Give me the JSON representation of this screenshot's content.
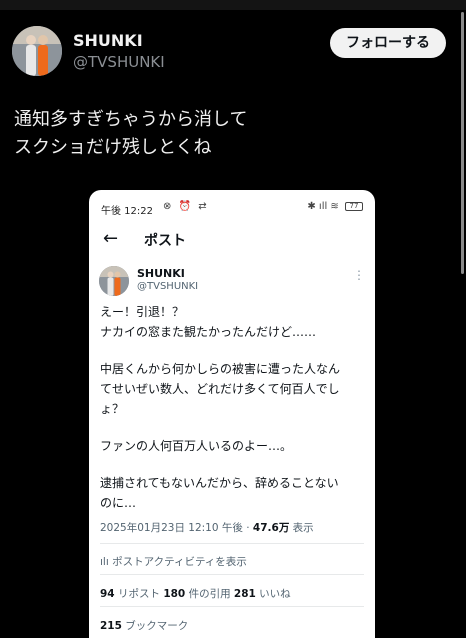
{
  "profile": {
    "name": "SHUNKI",
    "handle": "@TVSHUNKI",
    "follow_label": "フォローする"
  },
  "tweet": {
    "lines": [
      "通知多すぎちゃうから消して",
      "スクショだけ残しとくね"
    ]
  },
  "screenshot": {
    "status": {
      "time": "午後 12:22",
      "left_icons": "⊗ ⏰ ⇄",
      "right_icons": "✱ ıll ≋",
      "battery": "77"
    },
    "nav": {
      "back_icon": "back-arrow-icon",
      "title": "ポスト"
    },
    "author": {
      "name": "SHUNKI",
      "handle": "@TVSHUNKI",
      "more": "⋮"
    },
    "body": [
      "えー！引退！？",
      "ナカイの窓また観たかったんだけど……",
      "",
      "中居くんから何かしらの被害に遭った人なん",
      "てせいぜい数人、どれだけ多くて何百人でし",
      "ょ？",
      "",
      "ファンの人何百万人いるのよー…。",
      "",
      "逮捕されてもないんだから、辞めることない",
      "のに…"
    ],
    "meta": {
      "datetime": "2025年01月23日 12:10 午後 · ",
      "views": "47.6万",
      "views_suffix": " 表示"
    },
    "activity_label": "ポストアクティビティを表示",
    "stats": {
      "reposts": "94",
      "reposts_label": " リポスト ",
      "quotes": "180",
      "quotes_label": " 件の引用 ",
      "likes": "281",
      "likes_label": " いいね"
    },
    "bookmarks": {
      "count": "215",
      "label": " ブックマーク"
    }
  }
}
